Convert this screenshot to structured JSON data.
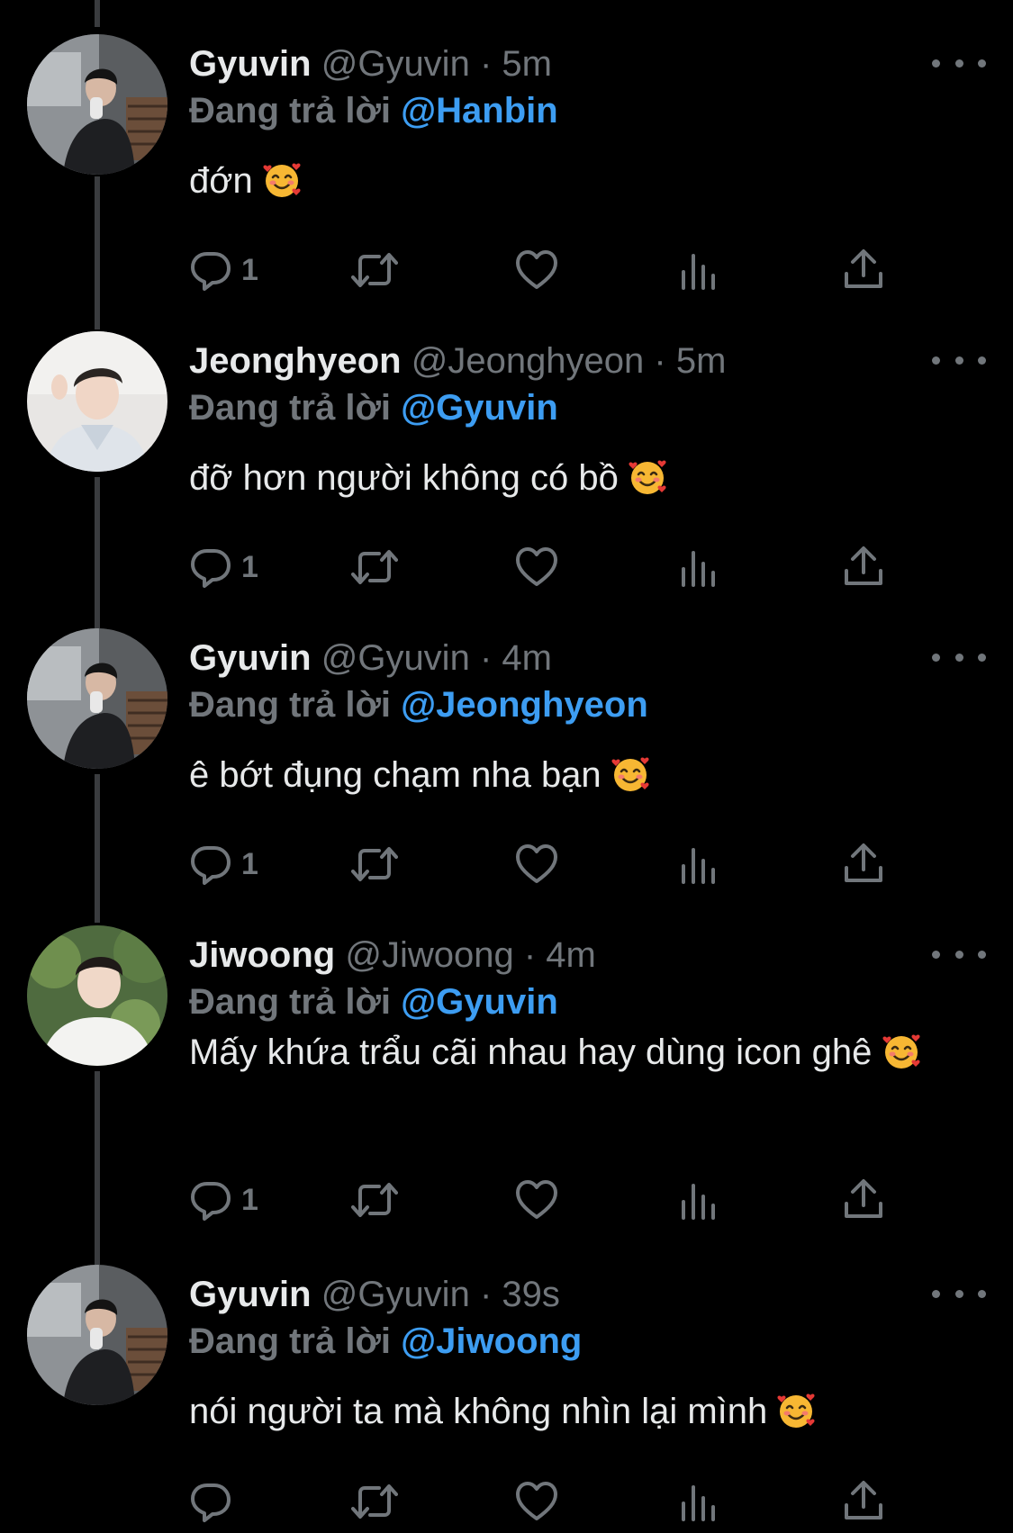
{
  "tweets": [
    {
      "name": "Gyuvin",
      "handle": "@Gyuvin",
      "dot": "·",
      "time": "5m",
      "reply_prefix": "Đang trả lời",
      "reply_to": "@Hanbin",
      "text": "đớn",
      "emoji": "smiling-face-with-hearts",
      "reply_count": "1",
      "avatar": "gyuvin-photo"
    },
    {
      "name": "Jeonghyeon",
      "handle": "@Jeonghyeon",
      "dot": "·",
      "time": "5m",
      "reply_prefix": "Đang trả lời",
      "reply_to": "@Gyuvin",
      "text": "đỡ hơn người không có bồ",
      "emoji": "smiling-face-with-hearts",
      "reply_count": "1",
      "avatar": "jeonghyeon-photo"
    },
    {
      "name": "Gyuvin",
      "handle": "@Gyuvin",
      "dot": "·",
      "time": "4m",
      "reply_prefix": "Đang trả lời",
      "reply_to": "@Jeonghyeon",
      "text": "ê bớt đụng chạm nha bạn",
      "emoji": "smiling-face-with-hearts",
      "reply_count": "1",
      "avatar": "gyuvin-photo"
    },
    {
      "name": "Jiwoong",
      "handle": "@Jiwoong",
      "dot": "·",
      "time": "4m",
      "reply_prefix": "Đang trả lời",
      "reply_to": "@Gyuvin",
      "text": "Mấy khứa trẩu cãi nhau hay dùng icon ghê",
      "emoji": "smiling-face-with-hearts",
      "reply_count": "1",
      "avatar": "jiwoong-photo"
    },
    {
      "name": "Gyuvin",
      "handle": "@Gyuvin",
      "dot": "·",
      "time": "39s",
      "reply_prefix": "Đang trả lời",
      "reply_to": "@Jiwoong",
      "text": "nói người ta mà không nhìn lại mình",
      "emoji": "smiling-face-with-hearts",
      "reply_count": "",
      "avatar": "gyuvin-photo"
    }
  ],
  "icons": {
    "reply": "reply-icon",
    "retweet": "retweet-icon",
    "like": "heart-icon",
    "views": "analytics-icon",
    "share": "share-icon",
    "more": "more-icon"
  },
  "colors": {
    "background": "#000000",
    "text": "#e7e9ea",
    "muted": "#71767b",
    "mention": "#3d9df2"
  }
}
